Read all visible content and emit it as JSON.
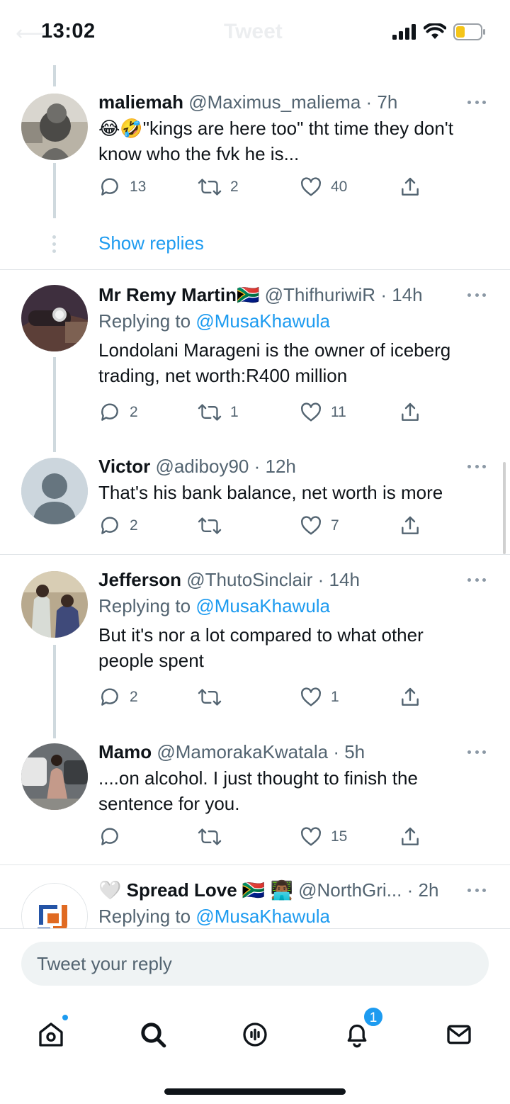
{
  "status_bar": {
    "time": "13:02"
  },
  "header": {
    "title": "Tweet"
  },
  "colors": {
    "accent": "#1d9bf0",
    "secondary_text": "#536471",
    "battery": "#f5c518"
  },
  "show_replies_label": "Show replies",
  "replying_to_label": "Replying to",
  "tweets": [
    {
      "name": "maliemah",
      "handle": "@Maximus_maliema",
      "time": "· 7h",
      "text": "😂🤣\"kings are here too\" tht time they don't know who the fvk he is...",
      "replies": "13",
      "retweets": "2",
      "likes": "40"
    },
    {
      "name": "Mr Remy Martin🇿🇦",
      "handle": "@ThifhuriwiR",
      "time": "· 14h",
      "replying_to": "@MusaKhawula",
      "text": "Londolani Marageni is the owner of iceberg trading, net worth:R400 million",
      "replies": "2",
      "retweets": "1",
      "likes": "11"
    },
    {
      "name": "Victor",
      "handle": "@adiboy90",
      "time": "· 12h",
      "text": "That's his bank balance, net worth is more",
      "replies": "2",
      "retweets": "",
      "likes": "7"
    },
    {
      "name": "Jefferson",
      "handle": "@ThutoSinclair",
      "time": "· 14h",
      "replying_to": "@MusaKhawula",
      "text": "But it's nor a lot compared to what other people spent",
      "replies": "2",
      "retweets": "",
      "likes": "1"
    },
    {
      "name": "Mamo",
      "handle": "@MamorakaKwatala",
      "time": "· 5h",
      "text": "....on alcohol. I just thought to finish the sentence for you.",
      "replies": "",
      "retweets": "",
      "likes": "15"
    },
    {
      "name": "🤍 Spread Love 🇿🇦 👨🏾‍💻",
      "handle": "@NorthGri...",
      "time": "· 2h",
      "replying_to": "@MusaKhawula"
    }
  ],
  "composer": {
    "placeholder": "Tweet your reply"
  },
  "tab_bar": {
    "items": [
      {
        "icon": "home-icon",
        "badge": "dot"
      },
      {
        "icon": "search-icon"
      },
      {
        "icon": "spaces-icon"
      },
      {
        "icon": "notifications-icon",
        "badge_count": "1"
      },
      {
        "icon": "messages-icon"
      }
    ]
  }
}
